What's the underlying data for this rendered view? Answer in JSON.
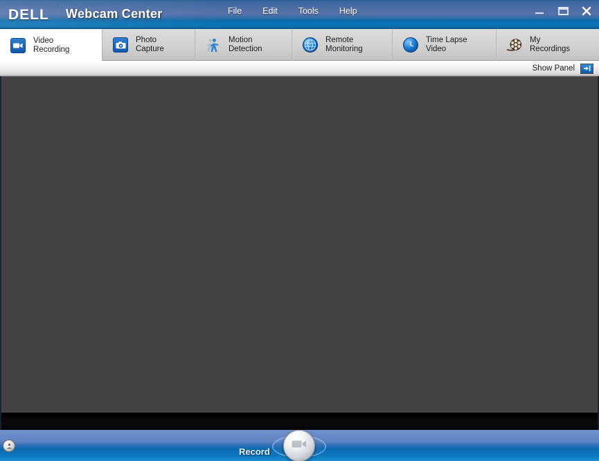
{
  "window": {
    "brand": "DELL",
    "title": "Webcam Center",
    "controls": {
      "minimize": "minimize-button",
      "maximize": "maximize-button",
      "close": "close-button"
    }
  },
  "menu": {
    "items": [
      {
        "label": "File"
      },
      {
        "label": "Edit"
      },
      {
        "label": "Tools"
      },
      {
        "label": "Help"
      }
    ]
  },
  "tabs": {
    "active_index": 0,
    "items": [
      {
        "label": "Video\nRecording",
        "icon": "camcorder-icon",
        "active": true
      },
      {
        "label": "Photo\nCapture",
        "icon": "camera-icon",
        "active": false
      },
      {
        "label": "Motion\nDetection",
        "icon": "walking-person-icon",
        "active": false
      },
      {
        "label": "Remote\nMonitoring",
        "icon": "globe-icon",
        "active": false
      },
      {
        "label": "Time Lapse\nVideo",
        "icon": "clock-circle-icon",
        "active": false
      },
      {
        "label": "My\nRecordings",
        "icon": "film-reel-icon",
        "active": false
      }
    ]
  },
  "panel_strip": {
    "show_panel_label": "Show Panel",
    "toggle_icon": "panel-expand-icon"
  },
  "viewport": {
    "state": "no-preview",
    "background_color": "#434343"
  },
  "bottom_bar": {
    "record_label": "Record",
    "record_button_icon": "camcorder-glyph",
    "settings_icon": "options-icon"
  },
  "colors": {
    "title_blue": "#4f6fa6",
    "accent_cyan": "#0b74b5",
    "tab_grey": "#d2d2d2",
    "tab_active": "#ffffff",
    "video_bg": "#434343",
    "bottom_blue": "#2f6fb5"
  }
}
